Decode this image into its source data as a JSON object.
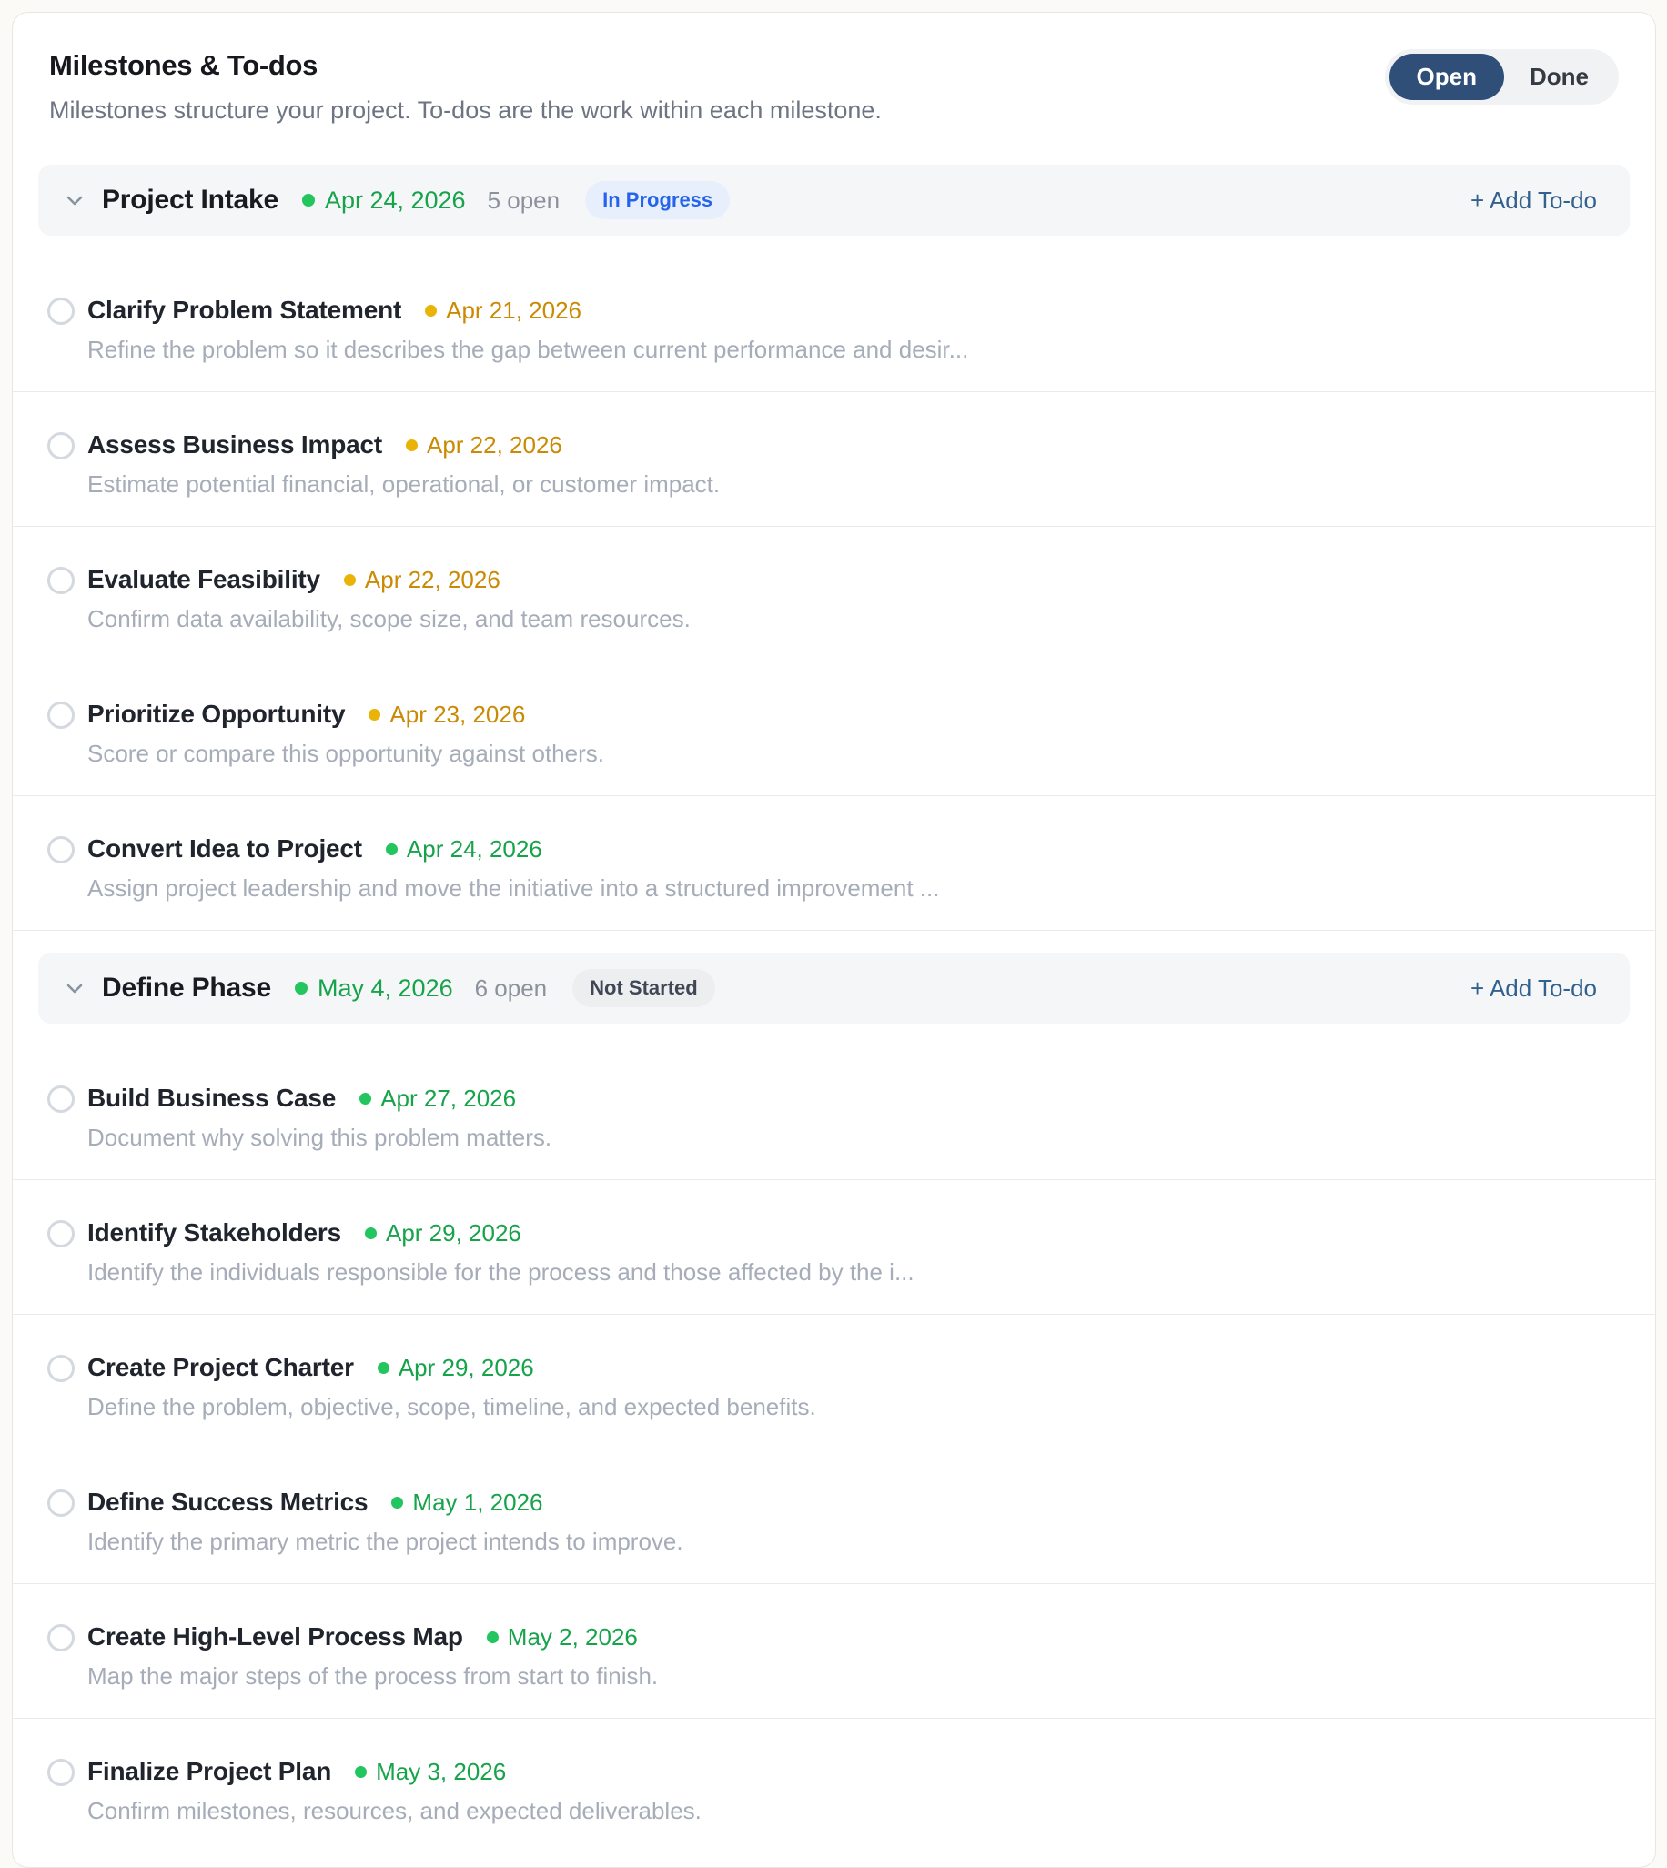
{
  "header": {
    "title": "Milestones & To-dos",
    "subtitle": "Milestones structure your project. To-dos are the work within each milestone.",
    "toggle": {
      "open_label": "Open",
      "done_label": "Done",
      "selected": "Open"
    }
  },
  "colors": {
    "toggle_active_bg": "#2f4f78",
    "green_text": "#16a34a",
    "green_dot": "#22c55e",
    "amber_text": "#ca8a04",
    "amber_dot": "#eab308",
    "status_blue_bg": "#e7effd",
    "status_blue_text": "#2563eb",
    "status_gray_bg": "#eceef0",
    "add_link": "#33618f"
  },
  "milestones": [
    {
      "name": "Project Intake",
      "date": "Apr 24, 2026",
      "date_color": "green",
      "open_count": "5 open",
      "status": {
        "label": "In Progress",
        "style": "blue"
      },
      "add_label": "+ Add To-do",
      "todos": [
        {
          "title": "Clarify Problem Statement",
          "date": "Apr 21, 2026",
          "date_color": "amber",
          "description": "Refine the problem so it describes the gap between current performance and desir..."
        },
        {
          "title": "Assess Business Impact",
          "date": "Apr 22, 2026",
          "date_color": "amber",
          "description": "Estimate potential financial, operational, or customer impact."
        },
        {
          "title": "Evaluate Feasibility",
          "date": "Apr 22, 2026",
          "date_color": "amber",
          "description": "Confirm data availability, scope size, and team resources."
        },
        {
          "title": "Prioritize Opportunity",
          "date": "Apr 23, 2026",
          "date_color": "amber",
          "description": "Score or compare this opportunity against others."
        },
        {
          "title": "Convert Idea to Project",
          "date": "Apr 24, 2026",
          "date_color": "green",
          "description": "Assign project leadership and move the initiative into a structured improvement ..."
        }
      ]
    },
    {
      "name": "Define Phase",
      "date": "May 4, 2026",
      "date_color": "green",
      "open_count": "6 open",
      "status": {
        "label": "Not Started",
        "style": "gray"
      },
      "add_label": "+ Add To-do",
      "todos": [
        {
          "title": "Build Business Case",
          "date": "Apr 27, 2026",
          "date_color": "green",
          "description": "Document why solving this problem matters."
        },
        {
          "title": "Identify Stakeholders",
          "date": "Apr 29, 2026",
          "date_color": "green",
          "description": "Identify the individuals responsible for the process and those affected by the i..."
        },
        {
          "title": "Create Project Charter",
          "date": "Apr 29, 2026",
          "date_color": "green",
          "description": "Define the problem, objective, scope, timeline, and expected benefits."
        },
        {
          "title": "Define Success Metrics",
          "date": "May 1, 2026",
          "date_color": "green",
          "description": "Identify the primary metric the project intends to improve."
        },
        {
          "title": "Create High-Level Process Map",
          "date": "May 2, 2026",
          "date_color": "green",
          "description": "Map the major steps of the process from start to finish."
        },
        {
          "title": "Finalize Project Plan",
          "date": "May 3, 2026",
          "date_color": "green",
          "description": "Confirm milestones, resources, and expected deliverables."
        }
      ]
    }
  ]
}
